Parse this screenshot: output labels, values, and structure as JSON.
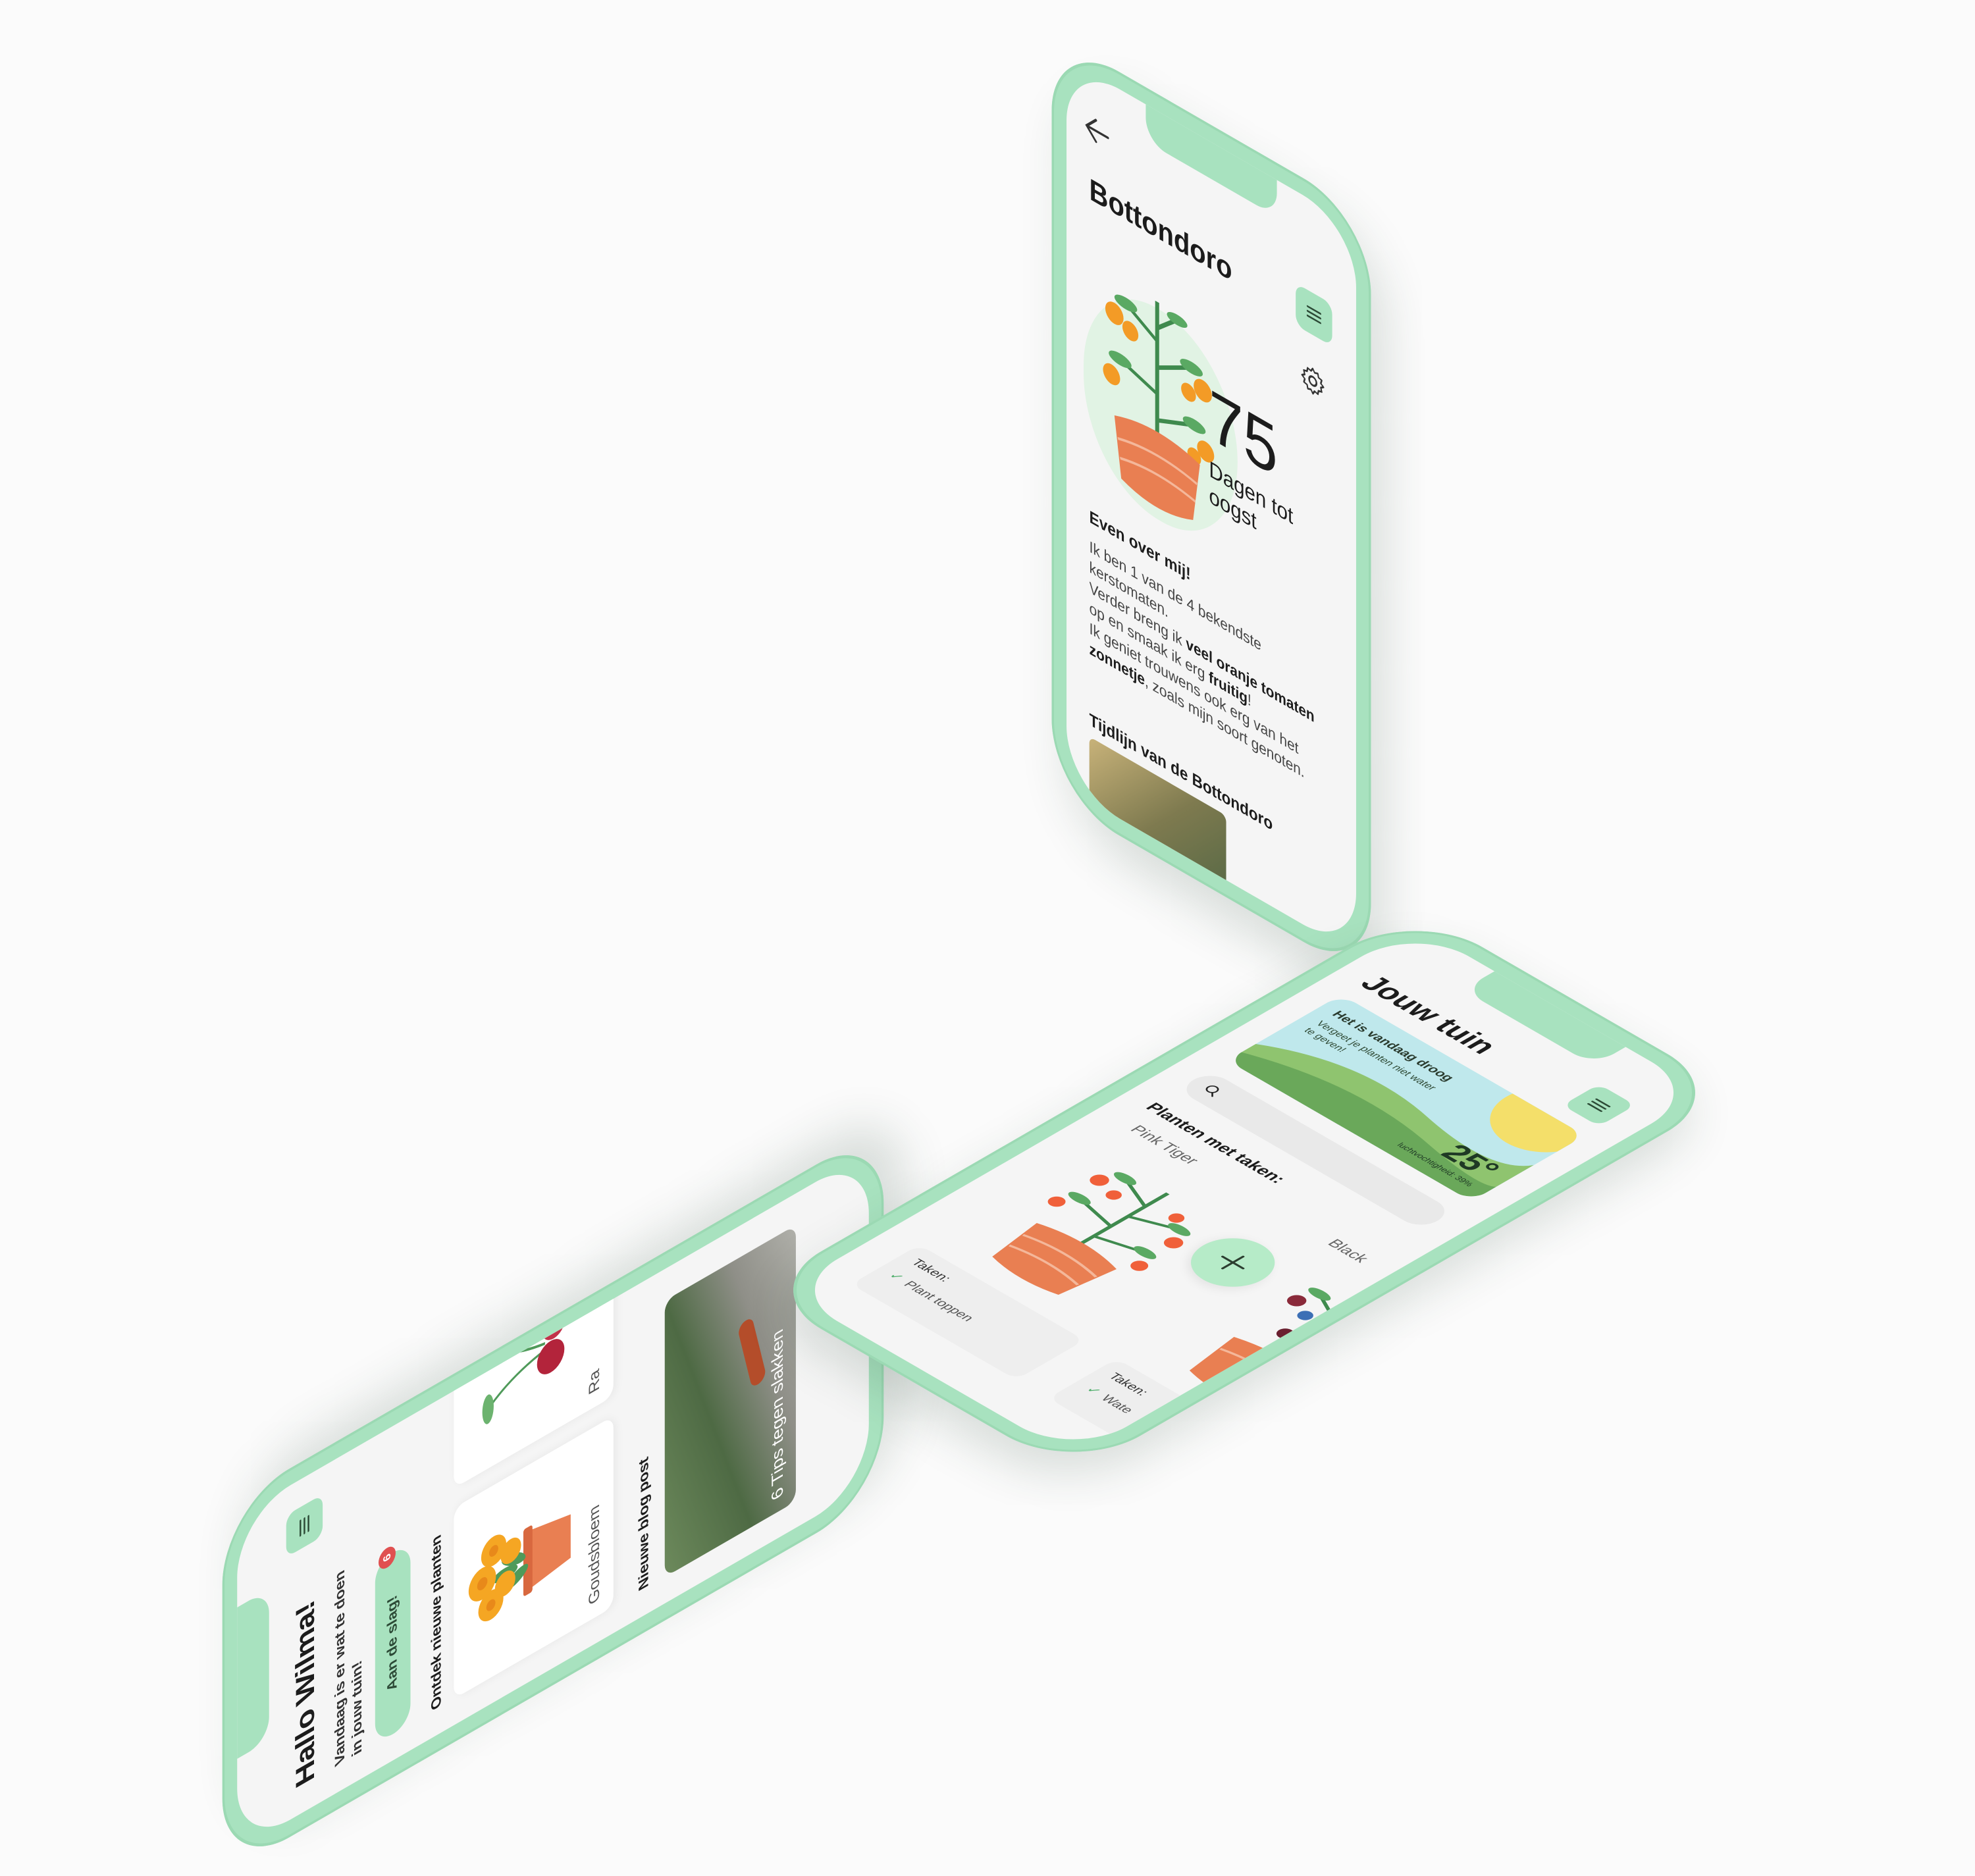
{
  "colors": {
    "frame": "#a8e2bf",
    "screen": "#f5f5f5",
    "accent_green": "#a8e2bf",
    "pot_orange": "#e97f52",
    "tomato_orange": "#f39b26",
    "badge_red": "#e05050"
  },
  "plant_detail": {
    "back_icon": "arrow-left-icon",
    "title": "Bottondoro",
    "menu_icon": "hamburger-menu-icon",
    "settings_icon": "gear-icon",
    "days_value": "75",
    "days_label": "Dagen tot oogst",
    "about_title": "Even over mij!",
    "about_line1": "Ik ben 1 van de 4 bekendste kerstomaten.",
    "about_line2_pre": "Verder breng ik ",
    "about_line2_bold": "veel oranje tomaten",
    "about_line2_post": " op en smaak ik erg ",
    "about_line2_bold2": "fruitig",
    "about_line2_end": "!",
    "about_line3_pre": "Ik geniet trouwens ook erg van het ",
    "about_line3_bold": "zonnetje",
    "about_line3_post": ", zoals mijn soort genoten.",
    "timeline_title": "Tijdlijn van de Bottondoro"
  },
  "home": {
    "greeting": "Hallo Wilma!",
    "menu_icon": "hamburger-menu-icon",
    "subtitle": "Vandaag is er wat te doen in jouw tuin!",
    "task_button": "Aan de slag!",
    "task_count": "6",
    "discover_title": "Ontdek nieuwe planten",
    "plants": [
      {
        "label": "Goudsbloem"
      },
      {
        "label": "Ra"
      }
    ],
    "blog_section": "Nieuwe blog post",
    "blog_title": "6 Tips tegen slakken"
  },
  "garden": {
    "title": "Jouw tuin",
    "menu_icon": "hamburger-menu-icon",
    "weather_title": "Het is vandaag droog",
    "weather_sub": "Vergeet je planten niet water te geven!",
    "temperature": "25°",
    "humidity": "luchtvochtigheid: 39%",
    "search_icon": "search-icon",
    "search_placeholder": "",
    "section_title": "Planten met taken:",
    "plant_a": {
      "name": "Pink Tiger",
      "tasks_label": "Taken:",
      "task": "Plant toppen"
    },
    "plant_b": {
      "name": "Black",
      "tasks_label": "Taken:",
      "task": "Wate"
    },
    "add_icon": "plus-icon"
  }
}
